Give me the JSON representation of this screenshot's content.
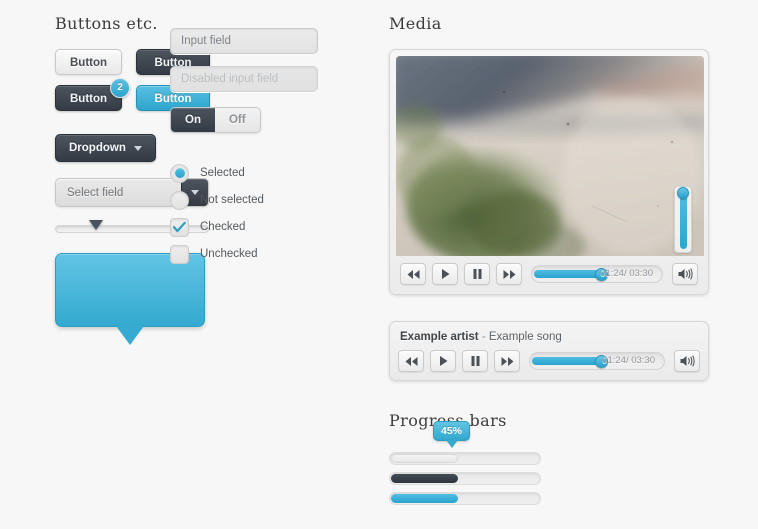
{
  "sections": {
    "buttons_title": "Buttons etc.",
    "media_title": "Media",
    "progress_title": "Progress bars"
  },
  "buttons": {
    "light_label": "Button",
    "dark_label": "Button",
    "dark_badge_label": "Button",
    "badge_count": "2",
    "blue_label": "Button",
    "dropdown_label": "Dropdown",
    "dropdown_icon": "chevron-down-icon"
  },
  "select": {
    "value": "Select field",
    "arrow_icon": "chevron-down-icon"
  },
  "slider": {
    "handle_position_percent": "22"
  },
  "inputs": {
    "input_placeholder": "Input field",
    "input_value": "",
    "disabled_placeholder": "Disabled input field",
    "disabled_value": ""
  },
  "toggle": {
    "on_label": "On",
    "off_label": "Off",
    "selected": "On"
  },
  "choices": [
    {
      "type": "radio",
      "label": "Selected",
      "checked": true
    },
    {
      "type": "radio",
      "label": "Not selected",
      "checked": false
    },
    {
      "type": "checkbox",
      "label": "Checked",
      "checked": true
    },
    {
      "type": "checkbox",
      "label": "Unchecked",
      "checked": false
    }
  ],
  "video_player": {
    "rewind_icon": "rewind-icon",
    "play_icon": "play-icon",
    "pause_icon": "pause-icon",
    "forward_icon": "fast-forward-icon",
    "volume_icon": "speaker-volume-icon",
    "time_display": "01:24/ 03:30",
    "elapsed": "01:24",
    "duration": "03:30",
    "seek_percent": "53",
    "volume_percent": "95"
  },
  "audio_player": {
    "artist": "Example artist",
    "separator": "-",
    "song": "Example song",
    "rewind_icon": "rewind-icon",
    "play_icon": "play-icon",
    "pause_icon": "pause-icon",
    "forward_icon": "fast-forward-icon",
    "volume_icon": "speaker-volume-icon",
    "time_display": "01:24/ 03:30",
    "seek_percent": "53"
  },
  "progress_bars": {
    "tooltip_label": "45%",
    "bars": [
      {
        "style": "grey",
        "percent": "45"
      },
      {
        "style": "dark",
        "percent": "45"
      },
      {
        "style": "blue",
        "percent": "45"
      }
    ]
  },
  "colors": {
    "accent_blue": "#2ca5ce",
    "dark_slate": "#3a424c",
    "page_bg": "#f7f7f7",
    "text": "#54595e"
  }
}
